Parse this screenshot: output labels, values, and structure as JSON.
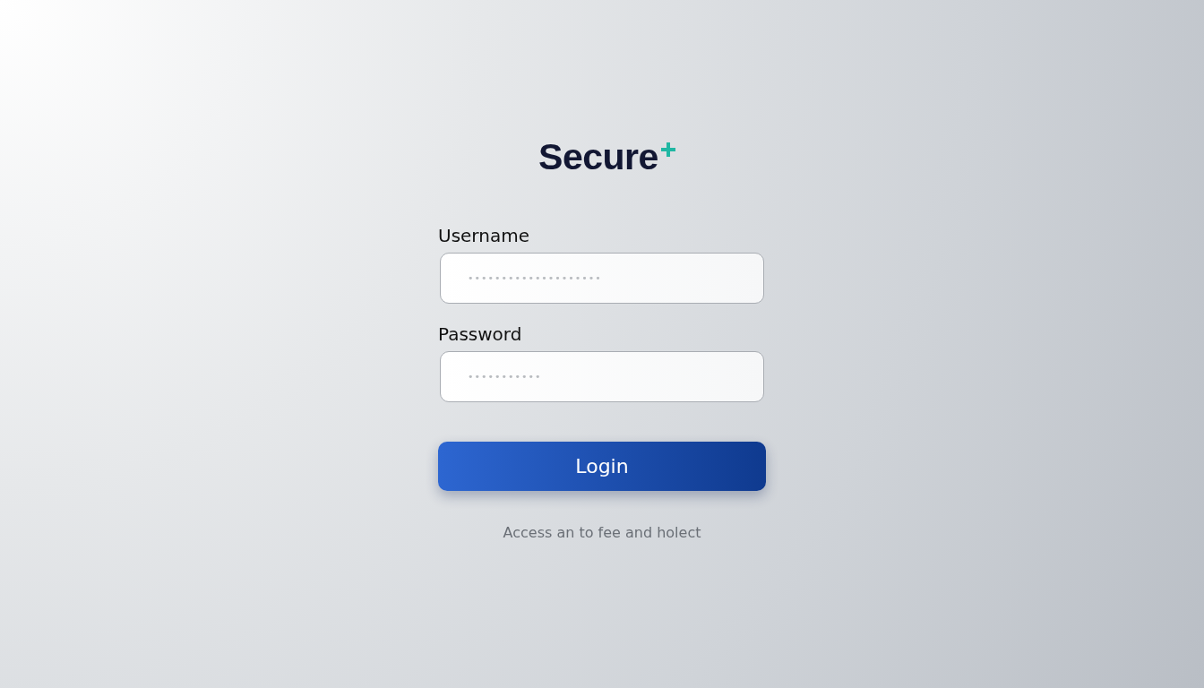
{
  "logo": {
    "text": "Secure"
  },
  "fields": [
    {
      "label": "Username",
      "value": "••••••••••••••••••••"
    },
    {
      "label": "Password",
      "value": "•••••••••••"
    }
  ],
  "login_button": {
    "label": "Login"
  },
  "footer_text": "Access an to fee and holect"
}
